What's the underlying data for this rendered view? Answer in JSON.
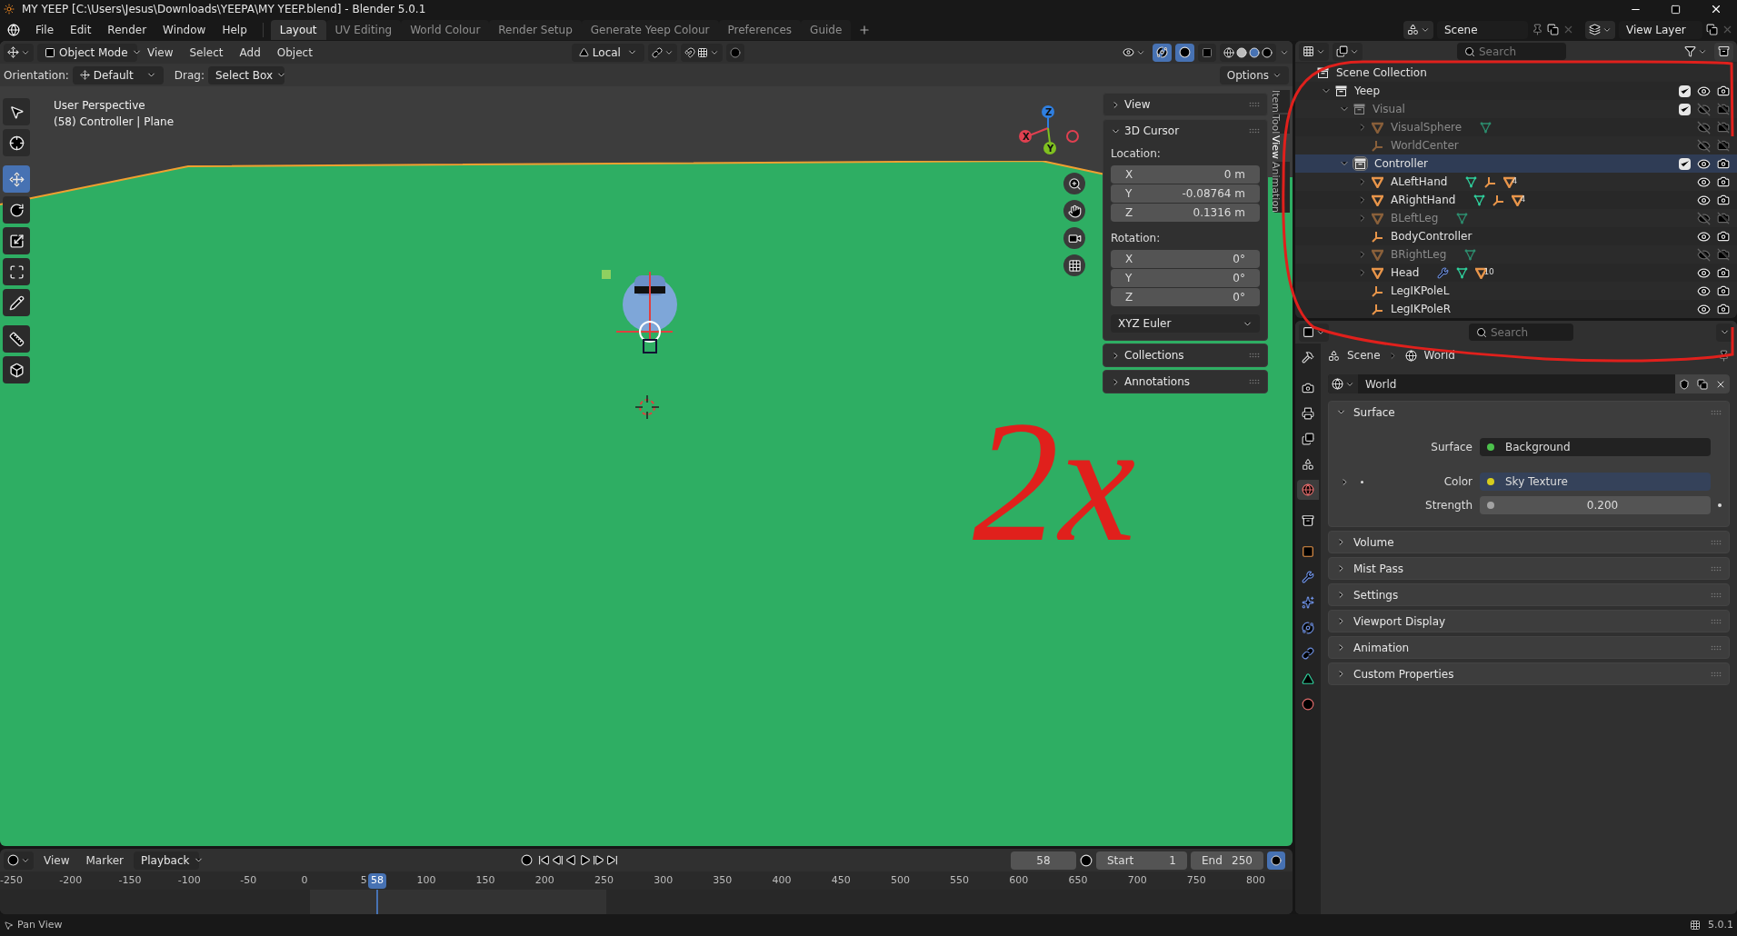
{
  "window": {
    "title": "MY YEEP [C:\\Users\\Jesus\\Downloads\\YEEPA\\MY YEEP.blend] - Blender 5.0.1"
  },
  "menu": [
    "File",
    "Edit",
    "Render",
    "Window",
    "Help"
  ],
  "workspaces": [
    {
      "label": "Layout",
      "selected": true
    },
    {
      "label": "UV Editing",
      "selected": false
    },
    {
      "label": "World Colour",
      "selected": false
    },
    {
      "label": "Render Setup",
      "selected": false
    },
    {
      "label": "Generate Yeep Colour",
      "selected": false
    },
    {
      "label": "Preferences",
      "selected": false
    },
    {
      "label": "Guide",
      "selected": false
    }
  ],
  "scene": {
    "name": "Scene"
  },
  "view_layer": {
    "name": "View Layer"
  },
  "viewport_header": {
    "mode": "Object Mode",
    "menus": [
      "View",
      "Select",
      "Add",
      "Object"
    ],
    "transform_orientation": "Local"
  },
  "tool_settings": {
    "orientation_label": "Orientation:",
    "orientation": "Default",
    "drag_label": "Drag:",
    "drag": "Select Box",
    "options": "Options"
  },
  "toolbar": [
    {
      "kind": "select",
      "selected": false
    },
    {
      "kind": "cursor",
      "selected": false
    },
    {
      "kind": "move",
      "selected": true
    },
    {
      "kind": "rotate",
      "selected": false
    },
    {
      "kind": "scale",
      "selected": false
    },
    {
      "kind": "transform",
      "selected": false
    },
    {
      "kind": "annotate",
      "selected": false
    },
    {
      "kind": "measure",
      "selected": false
    },
    {
      "kind": "add",
      "selected": false
    }
  ],
  "viewport": {
    "overlay_lines": [
      "User Perspective",
      "(58) Controller | Plane"
    ],
    "gizmo_axes": [
      "X",
      "Y",
      "Z"
    ]
  },
  "sidebar": {
    "tabs": [
      {
        "label": "Item",
        "selected": false
      },
      {
        "label": "Tool",
        "selected": false
      },
      {
        "label": "View",
        "selected": true
      },
      {
        "label": "Animation",
        "selected": false
      }
    ],
    "panels": [
      {
        "title": "View",
        "expanded": false
      },
      {
        "title": "3D Cursor",
        "expanded": true,
        "location_label": "Location:",
        "location": [
          {
            "axis": "X",
            "value": "0 m"
          },
          {
            "axis": "Y",
            "value": "-0.08764 m"
          },
          {
            "axis": "Z",
            "value": "0.1316 m"
          }
        ],
        "rotation_label": "Rotation:",
        "rotation": [
          {
            "axis": "X",
            "value": "0°"
          },
          {
            "axis": "Y",
            "value": "0°"
          },
          {
            "axis": "Z",
            "value": "0°"
          }
        ],
        "rotation_mode": "XYZ Euler"
      },
      {
        "title": "Collections",
        "expanded": false
      },
      {
        "title": "Annotations",
        "expanded": false
      }
    ]
  },
  "outliner": {
    "search_placeholder": "Search",
    "tree": [
      {
        "name": "Scene Collection",
        "kind": "scene",
        "selected": false,
        "children": [
          {
            "name": "Yeep",
            "kind": "collection",
            "expanded": true,
            "checked": true,
            "visible": true,
            "disabled": false,
            "selected": false,
            "children": [
              {
                "name": "Visual",
                "kind": "collection",
                "expanded": true,
                "checked": true,
                "visible": false,
                "disabled": true,
                "selected": false,
                "children": [
                  {
                    "name": "VisualSphere",
                    "kind": "mesh",
                    "expanded": false,
                    "visible": false,
                    "disabled": true,
                    "selected": false,
                    "extras": [
                      {
                        "kind": "mesh-data"
                      }
                    ]
                  },
                  {
                    "name": "WorldCenter",
                    "kind": "empty",
                    "visible": false,
                    "disabled": true,
                    "selected": false
                  }
                ]
              },
              {
                "name": "Controller",
                "kind": "collection",
                "expanded": true,
                "checked": true,
                "visible": true,
                "disabled": false,
                "selected": true,
                "children": [
                  {
                    "name": "ALeftHand",
                    "kind": "mesh",
                    "expanded": false,
                    "visible": true,
                    "disabled": false,
                    "selected": false,
                    "extras": [
                      {
                        "kind": "mesh-data"
                      },
                      {
                        "kind": "empty"
                      },
                      {
                        "kind": "mesh",
                        "count": "4"
                      }
                    ]
                  },
                  {
                    "name": "ARightHand",
                    "kind": "mesh",
                    "expanded": false,
                    "visible": true,
                    "disabled": false,
                    "selected": false,
                    "extras": [
                      {
                        "kind": "mesh-data"
                      },
                      {
                        "kind": "empty"
                      },
                      {
                        "kind": "mesh",
                        "count": "4"
                      }
                    ]
                  },
                  {
                    "name": "BLeftLeg",
                    "kind": "mesh",
                    "expanded": false,
                    "visible": false,
                    "disabled": true,
                    "selected": false,
                    "extras": [
                      {
                        "kind": "mesh-data"
                      }
                    ]
                  },
                  {
                    "name": "BodyController",
                    "kind": "empty",
                    "visible": true,
                    "disabled": false,
                    "selected": false
                  },
                  {
                    "name": "BRightLeg",
                    "kind": "mesh",
                    "expanded": false,
                    "visible": false,
                    "disabled": true,
                    "selected": false,
                    "extras": [
                      {
                        "kind": "mesh-data"
                      }
                    ]
                  },
                  {
                    "name": "Head",
                    "kind": "mesh",
                    "expanded": false,
                    "visible": true,
                    "disabled": false,
                    "selected": false,
                    "extras": [
                      {
                        "kind": "modifier"
                      },
                      {
                        "kind": "mesh-data"
                      },
                      {
                        "kind": "mesh",
                        "count": "10"
                      }
                    ]
                  },
                  {
                    "name": "LegIKPoleL",
                    "kind": "empty",
                    "visible": true,
                    "disabled": false,
                    "selected": false
                  },
                  {
                    "name": "LegIKPoleR",
                    "kind": "empty",
                    "visible": true,
                    "disabled": false,
                    "selected": false
                  }
                ]
              }
            ]
          }
        ]
      }
    ]
  },
  "properties": {
    "search_placeholder": "Search",
    "breadcrumb": [
      "Scene",
      "World"
    ],
    "tabs": [
      {
        "kind": "tool",
        "selected": false
      },
      {
        "kind": "render",
        "selected": false
      },
      {
        "kind": "output",
        "selected": false
      },
      {
        "kind": "view-layer",
        "selected": false
      },
      {
        "kind": "scene",
        "selected": false
      },
      {
        "kind": "world",
        "selected": true
      },
      {
        "kind": "collection",
        "selected": false
      },
      {
        "kind": "object",
        "selected": false
      },
      {
        "kind": "modifiers",
        "selected": false
      },
      {
        "kind": "particles",
        "selected": false
      },
      {
        "kind": "physics",
        "selected": false
      },
      {
        "kind": "constraints",
        "selected": false
      },
      {
        "kind": "data",
        "selected": false
      },
      {
        "kind": "material",
        "selected": false
      }
    ],
    "datablock": "World",
    "panels": [
      {
        "title": "Surface",
        "expanded": true,
        "rows": [
          {
            "kind": "shader",
            "label": "Surface",
            "value": "Background",
            "color": "#4cc14c"
          },
          {
            "kind": "linked",
            "label": "Color",
            "value": "Sky Texture",
            "color": "#d6cc1e"
          },
          {
            "kind": "number",
            "label": "Strength",
            "value": "0.200",
            "color": "#a3a3a3"
          }
        ]
      },
      {
        "title": "Volume",
        "expanded": false
      },
      {
        "title": "Mist Pass",
        "expanded": false
      },
      {
        "title": "Settings",
        "expanded": false
      },
      {
        "title": "Viewport Display",
        "expanded": false
      },
      {
        "title": "Animation",
        "expanded": false
      },
      {
        "title": "Custom Properties",
        "expanded": false
      }
    ]
  },
  "timeline": {
    "menus": [
      "View",
      "Marker",
      "Playback"
    ],
    "current_frame": "58",
    "start_label": "Start",
    "start": "1",
    "end_label": "End",
    "end": "250",
    "ruler": [
      "-250",
      "-200",
      "-150",
      "-100",
      "-50",
      "0",
      "5",
      "100",
      "150",
      "200",
      "250",
      "300",
      "350",
      "400",
      "450",
      "500",
      "550",
      "600",
      "650",
      "700",
      "750",
      "800"
    ],
    "playhead_frame": "58"
  },
  "status_bar": {
    "message": "Pan View",
    "version": "5.0.1"
  },
  "annotation": {
    "text": "2x"
  }
}
